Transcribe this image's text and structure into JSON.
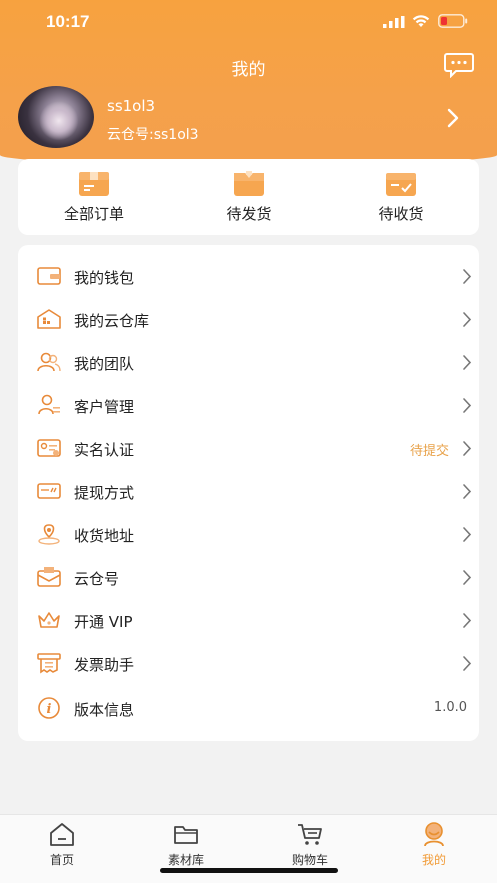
{
  "status_bar": {
    "time": "10:17"
  },
  "header": {
    "title": "我的"
  },
  "profile": {
    "username": "ss1ol3",
    "cloud_id": "云仓号:ss1ol3"
  },
  "orders": [
    {
      "label": "全部订单",
      "icon": "all-orders-box-icon"
    },
    {
      "label": "待发货",
      "icon": "pending-shipment-box-icon"
    },
    {
      "label": "待收货",
      "icon": "pending-receipt-box-icon"
    }
  ],
  "menu": [
    {
      "label": "我的钱包",
      "value": "",
      "icon": "wallet-icon"
    },
    {
      "label": "我的云仓库",
      "value": "",
      "icon": "warehouse-icon"
    },
    {
      "label": "我的团队",
      "value": "",
      "icon": "team-icon"
    },
    {
      "label": "客户管理",
      "value": "",
      "icon": "customer-icon"
    },
    {
      "label": "实名认证",
      "value": "待提交",
      "icon": "id-card-icon"
    },
    {
      "label": "提现方式",
      "value": "",
      "icon": "card-icon"
    },
    {
      "label": "收货地址",
      "value": "",
      "icon": "location-icon"
    },
    {
      "label": "云仓号",
      "value": "",
      "icon": "envelope-icon"
    },
    {
      "label": "开通 VIP",
      "value": "",
      "icon": "crown-icon"
    },
    {
      "label": "发票助手",
      "value": "",
      "icon": "invoice-icon"
    },
    {
      "label": "版本信息",
      "value": "1.0.0",
      "icon": "info-icon"
    }
  ],
  "tabs": [
    {
      "label": "首页",
      "icon": "home-icon"
    },
    {
      "label": "素材库",
      "icon": "folder-icon"
    },
    {
      "label": "购物车",
      "icon": "cart-icon"
    },
    {
      "label": "我的",
      "icon": "user-icon"
    }
  ],
  "colors": {
    "accent": "#f5a14a",
    "orange_text": "#f19b37",
    "pending_text": "#e8a24a"
  }
}
